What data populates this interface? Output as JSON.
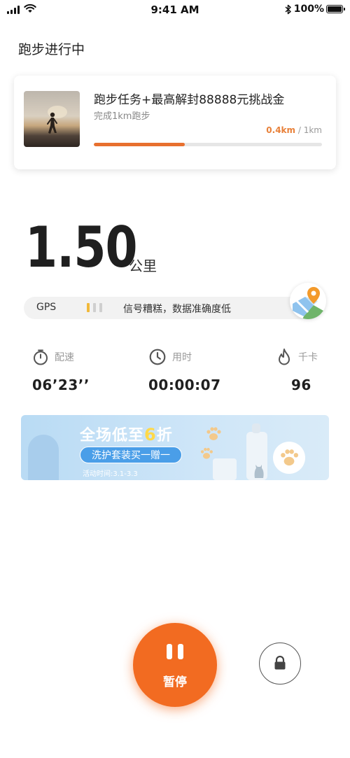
{
  "status_bar": {
    "time": "9:41 AM",
    "battery": "100%"
  },
  "page": {
    "title": "跑步进行中"
  },
  "task": {
    "title": "跑步任务+最高解封88888元挑战金",
    "subtitle": "完成1km跑步",
    "progress_done": "0.4km",
    "progress_sep": " / ",
    "progress_total": "1km",
    "progress_fraction": 0.4
  },
  "run": {
    "distance": "1.50",
    "distance_unit": "公里"
  },
  "gps": {
    "label": "GPS",
    "message": "信号糟糕，数据准确度低",
    "signal_level": 1,
    "signal_max": 3
  },
  "stats": [
    {
      "label": "配速",
      "value": "06’23’’",
      "icon": "stopwatch-icon"
    },
    {
      "label": "用时",
      "value": "00:00:07",
      "icon": "clock-icon"
    },
    {
      "label": "千卡",
      "value": "96",
      "icon": "flame-icon"
    }
  ],
  "banner": {
    "title_prefix": "全场低至",
    "title_highlight": "6",
    "title_suffix": "折",
    "pill": "洗护套装买一赠一",
    "date": "活动时间:3.1-3.3"
  },
  "controls": {
    "pause_label": "暂停"
  },
  "colors": {
    "accent": "#f26b21",
    "progress": "#e8702f",
    "gps_on": "#f1b93a",
    "banner_bg": "#cfe6f8"
  }
}
